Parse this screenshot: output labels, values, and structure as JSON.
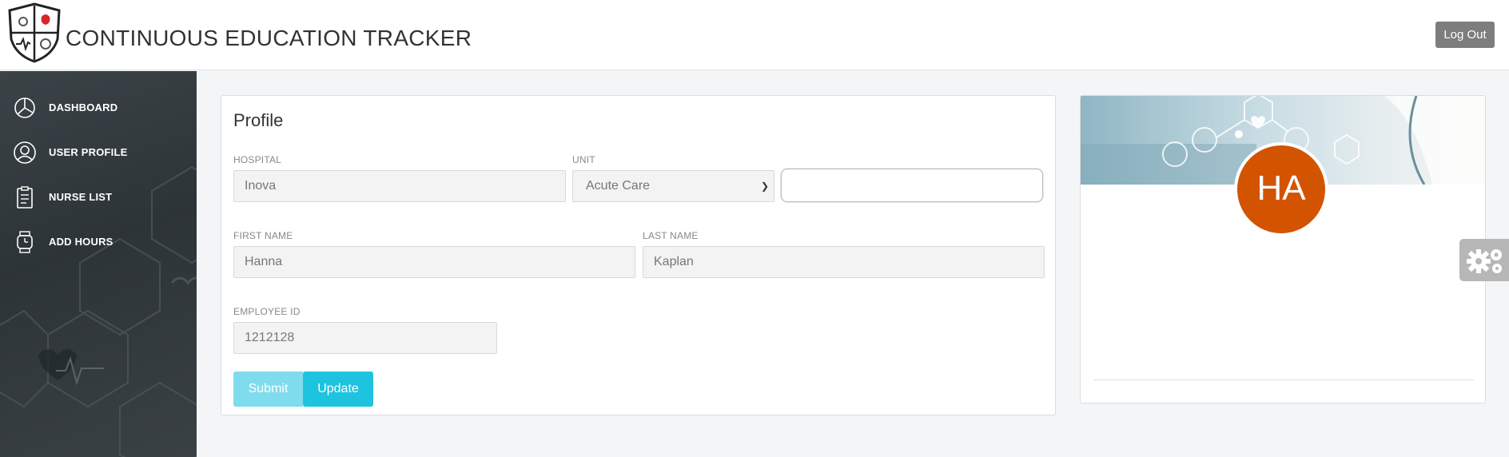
{
  "header": {
    "title": "CONTINUOUS EDUCATION TRACKER",
    "logout_label": "Log Out"
  },
  "sidebar": {
    "items": [
      {
        "label": "DASHBOARD",
        "icon": "pie-chart-icon"
      },
      {
        "label": "USER PROFILE",
        "icon": "user-icon"
      },
      {
        "label": "NURSE LIST",
        "icon": "clipboard-icon"
      },
      {
        "label": "ADD HOURS",
        "icon": "watch-icon"
      }
    ]
  },
  "profile": {
    "title": "Profile",
    "hospital": {
      "label": "HOSPITAL",
      "value": "Inova"
    },
    "unit": {
      "label": "UNIT",
      "value": "Acute Care"
    },
    "extra_input": {
      "value": ""
    },
    "first_name": {
      "label": "FIRST NAME",
      "value": "Hanna"
    },
    "last_name": {
      "label": "LAST NAME",
      "value": "Kaplan"
    },
    "employee_id": {
      "label": "EMPLOYEE ID",
      "value": "1212128"
    },
    "submit_label": "Submit",
    "update_label": "Update"
  },
  "avatar": {
    "initials": "HA",
    "color": "#d35400"
  },
  "colors": {
    "accent": "#1ec3e0",
    "sidebar": "#2f3539"
  }
}
